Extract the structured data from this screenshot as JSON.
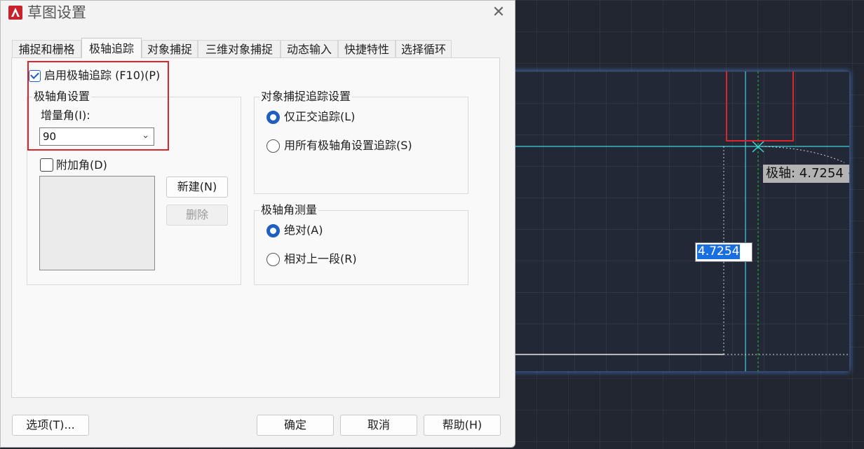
{
  "dialog": {
    "title": "草图设置",
    "close_symbol": "✕"
  },
  "tabs": [
    {
      "label": "捕捉和栅格",
      "active": false
    },
    {
      "label": "极轴追踪",
      "active": true
    },
    {
      "label": "对象捕捉",
      "active": false
    },
    {
      "label": "三维对象捕捉",
      "active": false
    },
    {
      "label": "动态输入",
      "active": false
    },
    {
      "label": "快捷特性",
      "active": false
    },
    {
      "label": "选择循环",
      "active": false
    }
  ],
  "polar": {
    "enable_label": "启用极轴追踪 (F10)(P)",
    "enable_checked": true,
    "angle_group_title": "极轴角设置",
    "increment_label": "增量角(I):",
    "increment_value": "90",
    "additional_label": "附加角(D)",
    "additional_checked": false,
    "new_button": "新建(N)",
    "delete_button": "删除"
  },
  "snap_tracking": {
    "title": "对象捕捉追踪设置",
    "options": [
      {
        "label": "仅正交追踪(L)",
        "selected": true
      },
      {
        "label": "用所有极轴角设置追踪(S)",
        "selected": false
      }
    ]
  },
  "measure": {
    "title": "极轴角测量",
    "options": [
      {
        "label": "绝对(A)",
        "selected": true
      },
      {
        "label": "相对上一段(R)",
        "selected": false
      }
    ]
  },
  "footer": {
    "options_button": "选项(T)...",
    "ok_button": "确定",
    "cancel_button": "取消",
    "help_button": "帮助(H)"
  },
  "preview": {
    "tooltip": "极轴: 4.7254 <",
    "input_value": "4.7254"
  },
  "colors": {
    "accent": "#1f5fbf",
    "highlight_box": "#d8262c",
    "tracking_line": "#3fd6e0",
    "cursor_line": "#2fbf3a",
    "canvas_bg": "#222835"
  }
}
